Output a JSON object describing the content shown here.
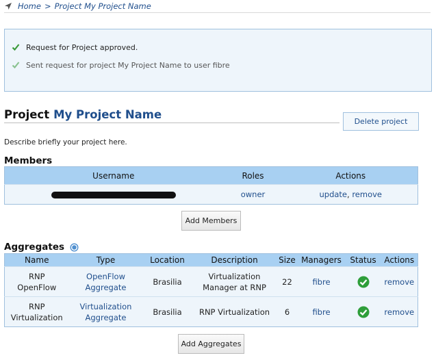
{
  "breadcrumb": {
    "home": "Home",
    "separator": ">",
    "current": "Project My Project Name"
  },
  "messages": [
    {
      "text": "Request for Project approved."
    },
    {
      "text": "Sent request for project My Project Name to user fibre"
    }
  ],
  "project": {
    "label": "Project",
    "name": "My Project Name",
    "delete_label": "Delete project",
    "description": "Describe briefly your project here."
  },
  "members": {
    "title": "Members",
    "columns": [
      "Username",
      "Roles",
      "Actions"
    ],
    "rows": [
      {
        "role": "owner",
        "update": "update",
        "sep": ",",
        "remove": "remove"
      }
    ],
    "add_label": "Add Members"
  },
  "aggregates": {
    "title": "Aggregates",
    "columns": [
      "Name",
      "Type",
      "Location",
      "Description",
      "Size",
      "Managers",
      "Status",
      "Actions"
    ],
    "rows": [
      {
        "name": [
          "RNP",
          "OpenFlow"
        ],
        "type": [
          "OpenFlow",
          "Aggregate"
        ],
        "location": "Brasilia",
        "description": [
          "Virtualization",
          "Manager at RNP"
        ],
        "size": "22",
        "manager": "fibre",
        "action": "remove"
      },
      {
        "name": [
          "RNP",
          "Virtualization"
        ],
        "type": [
          "Virtualization",
          "Aggregate"
        ],
        "location": "Brasilia",
        "description": [
          "RNP Virtualization"
        ],
        "size": "6",
        "manager": "fibre",
        "action": "remove"
      }
    ],
    "add_label": "Add Aggregates"
  },
  "colors": {
    "link": "#1f4e8c",
    "header": "#a8d0f2",
    "row": "#eef5fb",
    "status_ok": "#2e9e3a"
  }
}
